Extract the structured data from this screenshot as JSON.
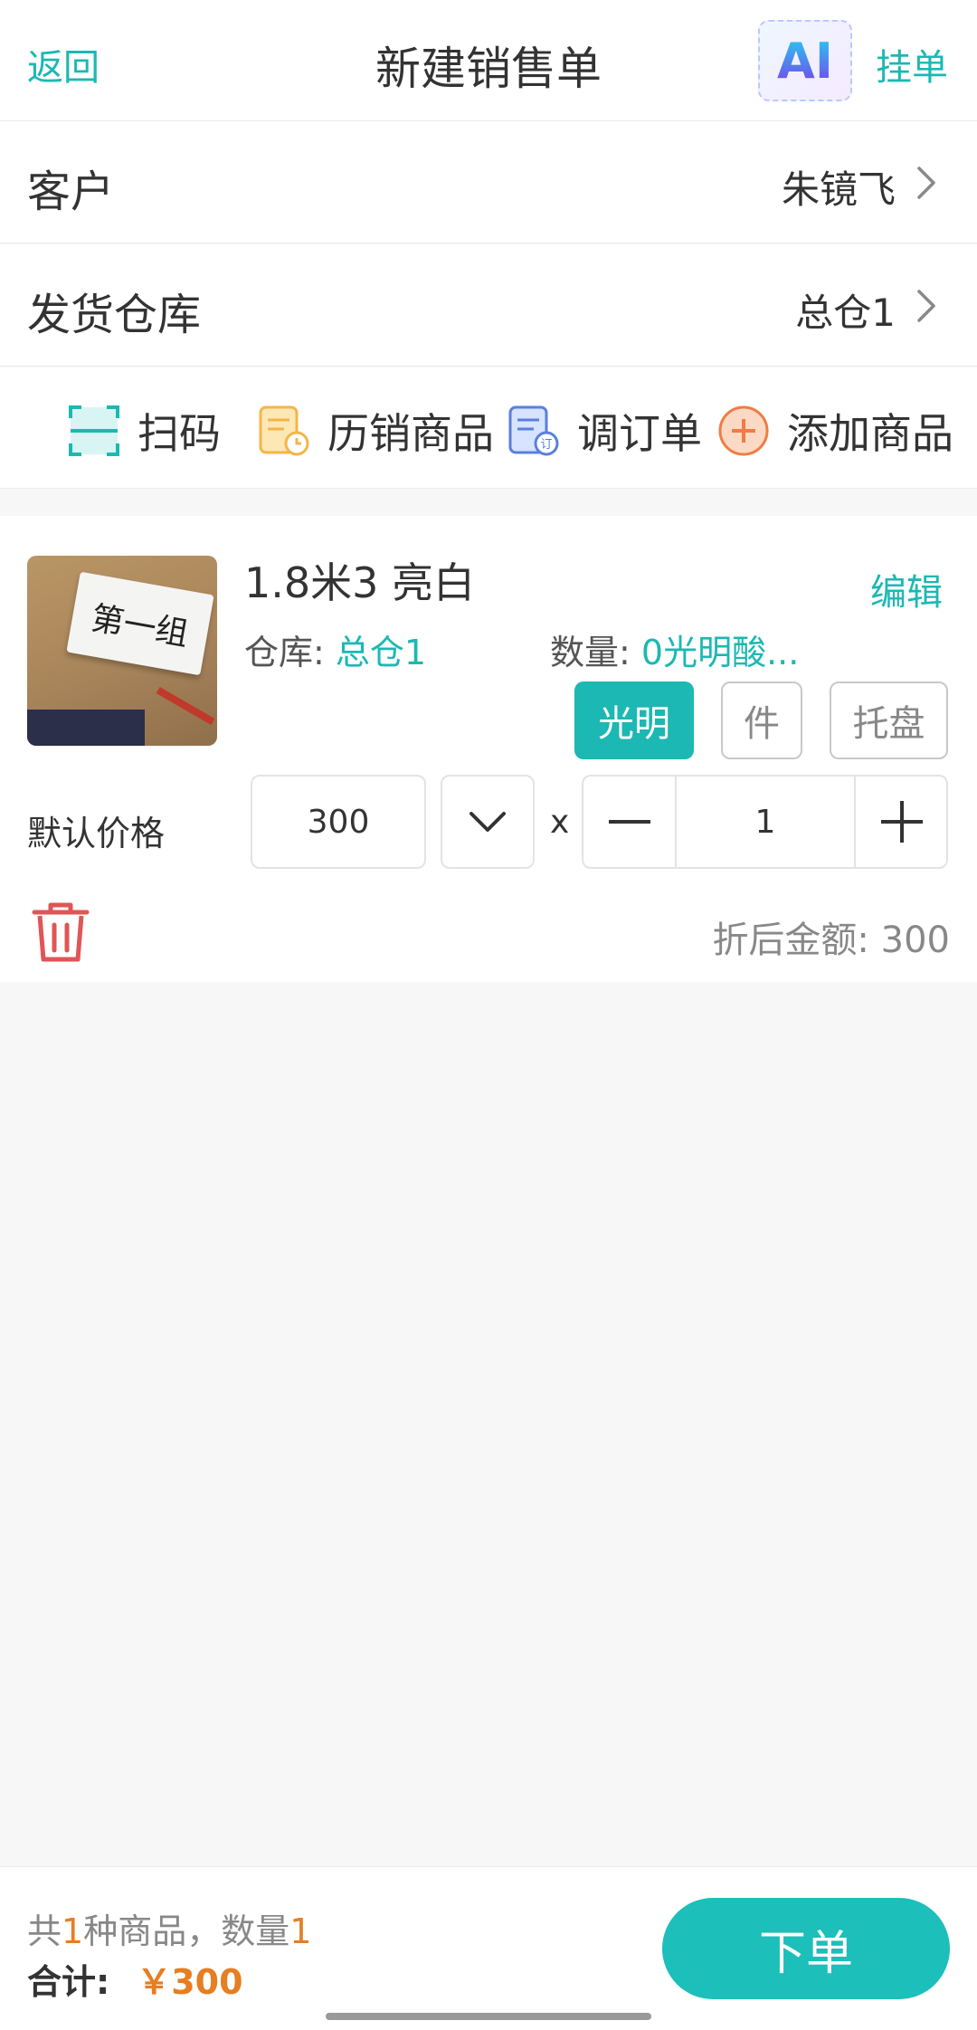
{
  "header": {
    "back_label": "返回",
    "title": "新建销售单",
    "ai_label": "AI",
    "hang_label": "挂单"
  },
  "customer": {
    "label": "客户",
    "value": "朱镜飞"
  },
  "warehouse": {
    "label": "发货仓库",
    "value": "总仓1"
  },
  "actions": [
    {
      "label": "扫码",
      "icon": "scan-icon"
    },
    {
      "label": "历销商品",
      "icon": "history-icon"
    },
    {
      "label": "调订单",
      "icon": "order-doc-icon"
    },
    {
      "label": "添加商品",
      "icon": "add-circle-icon"
    }
  ],
  "item": {
    "thumbnail_text": "第一组",
    "name": "1.8米3 亮白",
    "edit_label": "编辑",
    "warehouse_label": "仓库:",
    "warehouse_value": "总仓1",
    "quantity_label": "数量:",
    "quantity_value": "0光明酸...",
    "units": [
      "光明",
      "件",
      "托盘"
    ],
    "selected_unit": "光明",
    "price_label": "默认价格",
    "price_value": "300",
    "times_sign": "x",
    "quantity": "1",
    "discount_label": "折后金额:",
    "discount_value": "300"
  },
  "footer": {
    "summary_prefix": "共",
    "kinds": "1",
    "summary_mid": "种商品，数量",
    "count": "1",
    "total_label": "合计:",
    "total_value": "￥300",
    "order_label": "下单"
  },
  "colors": {
    "accent": "#1cb8b3",
    "price": "#e67e22",
    "delete": "#e05555"
  }
}
